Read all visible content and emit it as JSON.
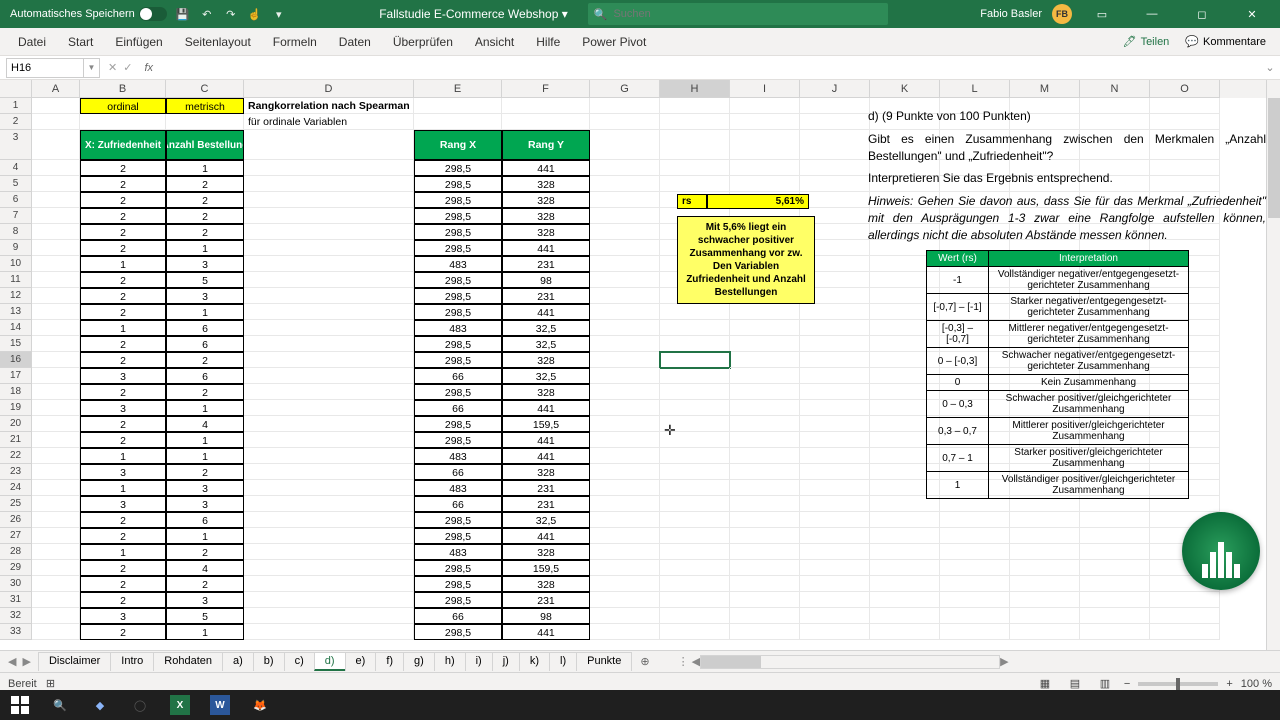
{
  "titlebar": {
    "autosave": "Automatisches Speichern",
    "doc": "Fallstudie E-Commerce Webshop",
    "search_placeholder": "Suchen",
    "user_name": "Fabio Basler",
    "user_initials": "FB"
  },
  "ribbon": {
    "tabs": [
      "Datei",
      "Start",
      "Einfügen",
      "Seitenlayout",
      "Formeln",
      "Daten",
      "Überprüfen",
      "Ansicht",
      "Hilfe",
      "Power Pivot"
    ],
    "share": "Teilen",
    "comments": "Kommentare"
  },
  "namebox": "H16",
  "fx": "fx",
  "columns": [
    "A",
    "B",
    "C",
    "D",
    "E",
    "F",
    "G",
    "H",
    "I",
    "J",
    "K",
    "L",
    "M",
    "N",
    "O"
  ],
  "header_row1": {
    "B": "ordinal",
    "C": "metrisch",
    "D": "Rangkorrelation nach Spearman"
  },
  "header_row2": {
    "D": "für ordinale Variablen"
  },
  "green_headers": {
    "B": "X: Zufriedenheit",
    "C": "Y: Anzahl Bestellungen",
    "E": "Rang X",
    "F": "Rang Y"
  },
  "rows": [
    {
      "n": 4,
      "B": "2",
      "C": "1",
      "E": "298,5",
      "F": "441"
    },
    {
      "n": 5,
      "B": "2",
      "C": "2",
      "E": "298,5",
      "F": "328"
    },
    {
      "n": 6,
      "B": "2",
      "C": "2",
      "E": "298,5",
      "F": "328"
    },
    {
      "n": 7,
      "B": "2",
      "C": "2",
      "E": "298,5",
      "F": "328"
    },
    {
      "n": 8,
      "B": "2",
      "C": "2",
      "E": "298,5",
      "F": "328"
    },
    {
      "n": 9,
      "B": "2",
      "C": "1",
      "E": "298,5",
      "F": "441"
    },
    {
      "n": 10,
      "B": "1",
      "C": "3",
      "E": "483",
      "F": "231"
    },
    {
      "n": 11,
      "B": "2",
      "C": "5",
      "E": "298,5",
      "F": "98"
    },
    {
      "n": 12,
      "B": "2",
      "C": "3",
      "E": "298,5",
      "F": "231"
    },
    {
      "n": 13,
      "B": "2",
      "C": "1",
      "E": "298,5",
      "F": "441"
    },
    {
      "n": 14,
      "B": "1",
      "C": "6",
      "E": "483",
      "F": "32,5"
    },
    {
      "n": 15,
      "B": "2",
      "C": "6",
      "E": "298,5",
      "F": "32,5"
    },
    {
      "n": 16,
      "B": "2",
      "C": "2",
      "E": "298,5",
      "F": "328"
    },
    {
      "n": 17,
      "B": "3",
      "C": "6",
      "E": "66",
      "F": "32,5"
    },
    {
      "n": 18,
      "B": "2",
      "C": "2",
      "E": "298,5",
      "F": "328"
    },
    {
      "n": 19,
      "B": "3",
      "C": "1",
      "E": "66",
      "F": "441"
    },
    {
      "n": 20,
      "B": "2",
      "C": "4",
      "E": "298,5",
      "F": "159,5"
    },
    {
      "n": 21,
      "B": "2",
      "C": "1",
      "E": "298,5",
      "F": "441"
    },
    {
      "n": 22,
      "B": "1",
      "C": "1",
      "E": "483",
      "F": "441"
    },
    {
      "n": 23,
      "B": "3",
      "C": "2",
      "E": "66",
      "F": "328"
    },
    {
      "n": 24,
      "B": "1",
      "C": "3",
      "E": "483",
      "F": "231"
    },
    {
      "n": 25,
      "B": "3",
      "C": "3",
      "E": "66",
      "F": "231"
    },
    {
      "n": 26,
      "B": "2",
      "C": "6",
      "E": "298,5",
      "F": "32,5"
    },
    {
      "n": 27,
      "B": "2",
      "C": "1",
      "E": "298,5",
      "F": "441"
    },
    {
      "n": 28,
      "B": "1",
      "C": "2",
      "E": "483",
      "F": "328"
    },
    {
      "n": 29,
      "B": "2",
      "C": "4",
      "E": "298,5",
      "F": "159,5"
    },
    {
      "n": 30,
      "B": "2",
      "C": "2",
      "E": "298,5",
      "F": "328"
    },
    {
      "n": 31,
      "B": "2",
      "C": "3",
      "E": "298,5",
      "F": "231"
    },
    {
      "n": 32,
      "B": "3",
      "C": "5",
      "E": "66",
      "F": "98"
    },
    {
      "n": 33,
      "B": "2",
      "C": "1",
      "E": "298,5",
      "F": "441"
    }
  ],
  "rs": {
    "label": "rs",
    "value": "5,61%"
  },
  "interp_box": "Mit 5,6% liegt ein schwacher positiver Zusammenhang vor zw. Den Variablen Zufriedenheit und Anzahl Bestellungen",
  "doc": {
    "title": "d) (9 Punkte von 100 Punkten)",
    "p1": "Gibt es einen Zusammenhang zwischen den Merkmalen „Anzahl Bestellungen\" und „Zufriedenheit\"?",
    "p2": "Interpretieren Sie das Ergebnis entsprechend.",
    "hint": "Hinweis: Gehen Sie davon aus, dass Sie für das Merkmal „Zufriedenheit\" mit den Ausprägungen 1-3 zwar eine Rangfolge aufstellen können, allerdings nicht die absoluten Abstände messen können."
  },
  "interp_table": {
    "h1": "Wert (rs)",
    "h2": "Interpretation",
    "rows": [
      [
        "-1",
        "Vollständiger negativer/entgegengesetzt-gerichteter Zusammenhang"
      ],
      [
        "[-0,7] – [-1]",
        "Starker negativer/entgegengesetzt-gerichteter Zusammenhang"
      ],
      [
        "[-0,3] – [-0,7]",
        "Mittlerer negativer/entgegengesetzt-gerichteter Zusammenhang"
      ],
      [
        "0 – [-0,3]",
        "Schwacher negativer/entgegengesetzt-gerichteter Zusammenhang"
      ],
      [
        "0",
        "Kein Zusammenhang"
      ],
      [
        "0 – 0,3",
        "Schwacher positiver/gleichgerichteter Zusammenhang"
      ],
      [
        "0,3 – 0,7",
        "Mittlerer positiver/gleichgerichteter Zusammenhang"
      ],
      [
        "0,7 – 1",
        "Starker positiver/gleichgerichteter Zusammenhang"
      ],
      [
        "1",
        "Vollständiger positiver/gleichgerichteter Zusammenhang"
      ]
    ]
  },
  "sheet_tabs": [
    "Disclaimer",
    "Intro",
    "Rohdaten",
    "a)",
    "b)",
    "c)",
    "d)",
    "e)",
    "f)",
    "g)",
    "h)",
    "i)",
    "j)",
    "k)",
    "l)",
    "Punkte"
  ],
  "active_tab": "d)",
  "status": {
    "ready": "Bereit",
    "zoom": "100 %"
  }
}
